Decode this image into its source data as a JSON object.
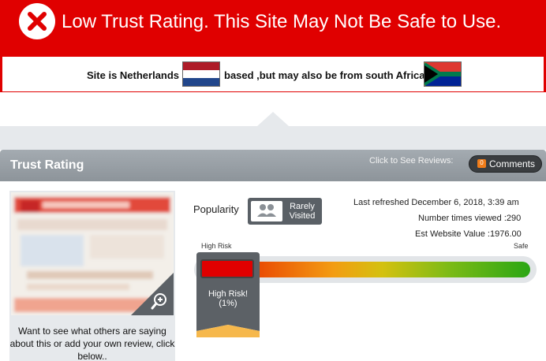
{
  "banner": {
    "title": "Low Trust Rating. This Site May Not Be Safe to Use.",
    "location_text_1": "Site is Netherlands",
    "location_text_2": "based ,but may also be from south Africa",
    "color": "#e00000"
  },
  "trust_rating": {
    "title": "Trust Rating",
    "click_to_see_reviews": "Click to See Reviews:",
    "comments_label": "Comments",
    "comments_count": "0"
  },
  "thumbnail": {
    "caption": "Want to see what others are saying about this or add your own review, click below.."
  },
  "popularity": {
    "label": "Popularity",
    "badge": "Rarely Visited"
  },
  "stats": {
    "last_refreshed": "Last refreshed December 6, 2018, 3:39 am",
    "times_viewed": "Number times viewed :290",
    "website_value": "Est Website Value :1976.00"
  },
  "meter": {
    "high_risk_label": "High Risk",
    "safe_label": "Safe",
    "pointer_label_1": "High Risk!",
    "pointer_label_2": "(1%)",
    "trust_percent": 1
  }
}
